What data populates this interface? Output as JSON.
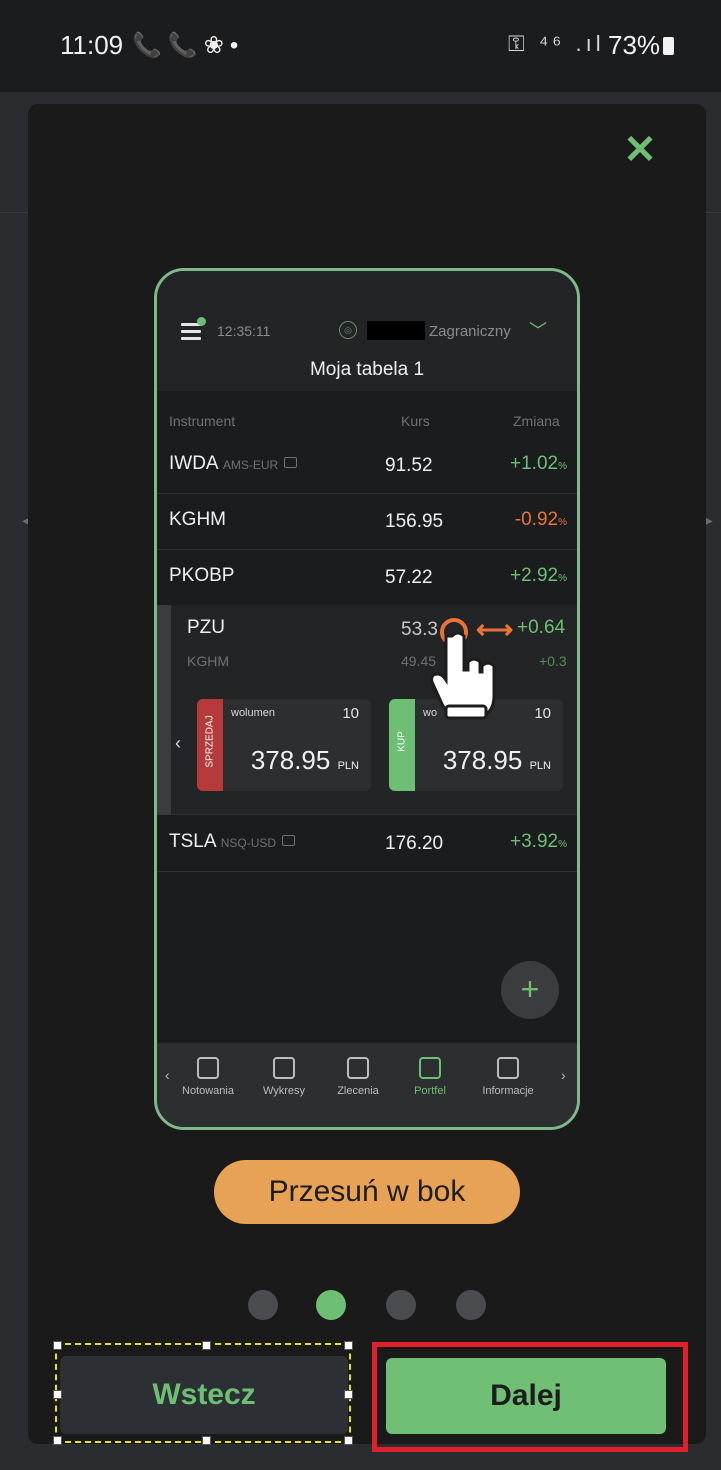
{
  "status_bar": {
    "time": "11:09",
    "left_icons": "📞📞❀•",
    "right_icons": "⚿ ⁴⁶ .ıl",
    "battery": "73%"
  },
  "modal": {
    "close_icon": "✕",
    "phone_preview": {
      "time": "12:35:11",
      "market": "Zagraniczny",
      "table_title": "Moja tabela 1",
      "columns": {
        "instrument": "Instrument",
        "price": "Kurs",
        "change": "Zmiana"
      },
      "rows": [
        {
          "symbol": "IWDA",
          "market": "AMS-EUR",
          "price": "91.52",
          "change": "+1.02",
          "unit": "%"
        },
        {
          "symbol": "KGHM",
          "market": "",
          "price": "156.95",
          "change": "-0.92",
          "unit": "%"
        },
        {
          "symbol": "PKOBP",
          "market": "",
          "price": "57.22",
          "change": "+2.92",
          "unit": "%"
        },
        {
          "symbol": "TSLA",
          "market": "NSQ-USD",
          "price": "176.20",
          "change": "+3.92",
          "unit": "%"
        }
      ],
      "expanded": {
        "symbol": "PZU",
        "price": "53.3",
        "change": "+0.64",
        "sub_symbol": "KGHM",
        "sub_price": "49.45",
        "sub_change": "+0.3",
        "sell_label": "SPRZEDAJ",
        "buy_label": "KUP",
        "volume_label": "wolumen",
        "volume_label_buy": "wo",
        "qty": "10",
        "sell_price": "378.95",
        "buy_price": "378.95",
        "currency": "PLN"
      },
      "nav": [
        "Notowania",
        "Wykresy",
        "Zlecenia",
        "Portfel",
        "Informacje"
      ],
      "nav_active": "Portfel"
    },
    "hint": "Przesuń w bok",
    "pages": {
      "total": 4,
      "current": 2
    },
    "back_label": "Wstecz",
    "next_label": "Dalej"
  }
}
